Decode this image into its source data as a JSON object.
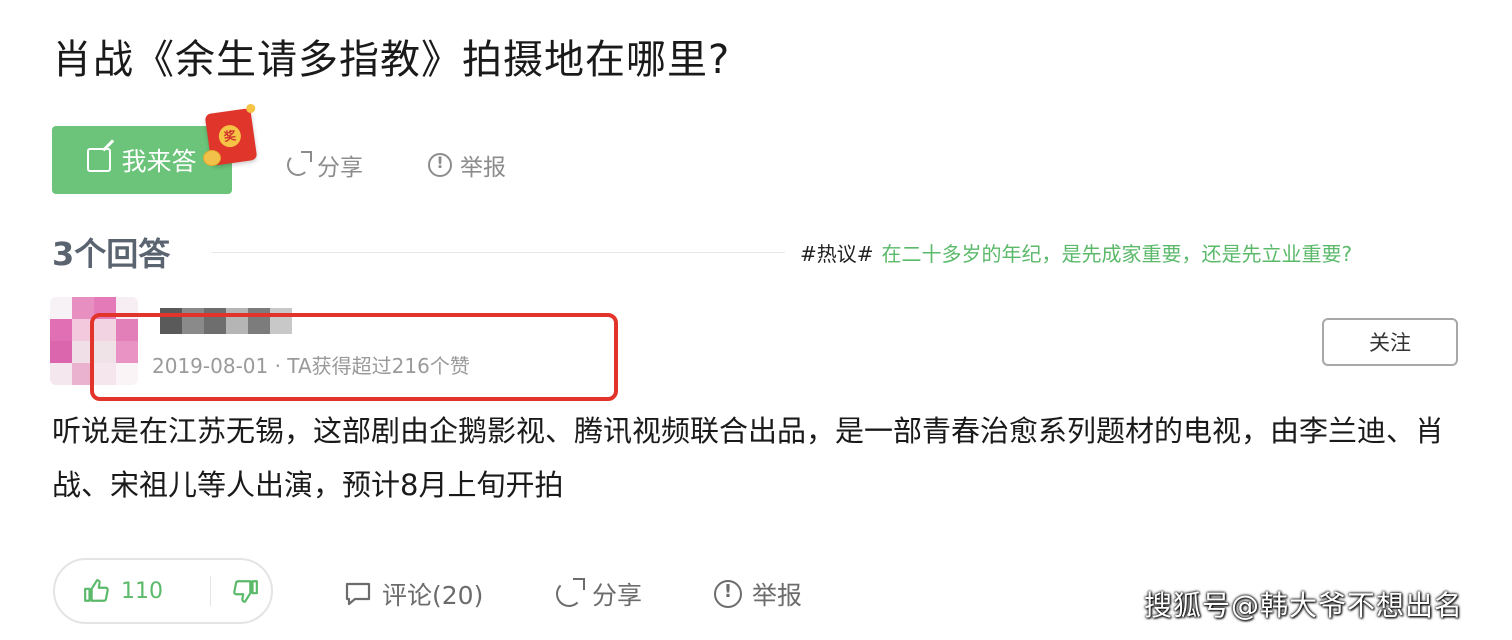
{
  "question": {
    "title": "肖战《余生请多指教》拍摄地在哪里?"
  },
  "question_actions": {
    "answer_label": "我来答",
    "reward_badge": "奖",
    "share_label": "分享",
    "report_label": "举报"
  },
  "answers_header": {
    "count_label": "3个回答",
    "hot_tag": "#热议#",
    "hot_link": "在二十多岁的年纪，是先成家重要，还是先立业重要?"
  },
  "answer": {
    "meta": "2019-08-01 · TA获得超过216个赞",
    "follow_label": "关注",
    "content": "听说是在江苏无锡，这部剧由企鹅影视、腾讯视频联合出品，是一部青春治愈系列题材的电视，由李兰迪、肖战、宋祖儿等人出演，预计8月上旬开拍"
  },
  "answer_actions": {
    "upvote_count": "110",
    "comment_label": "评论(20)",
    "share_label": "分享",
    "report_label": "举报"
  },
  "watermark": "搜狐号@韩大爷不想出名",
  "colors": {
    "accent_green": "#6cc47a",
    "link_green": "#5bb96a",
    "highlight_red": "#e2342b"
  }
}
